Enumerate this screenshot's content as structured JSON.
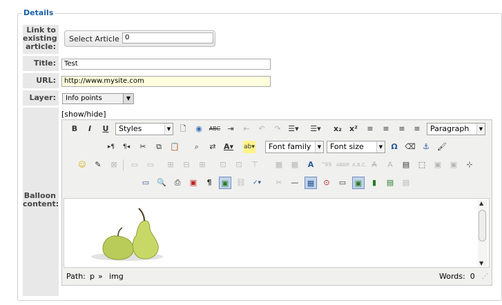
{
  "legend": "Details",
  "labels": {
    "link": "Link to existing article:",
    "title": "Title:",
    "url": "URL:",
    "layer": "Layer:",
    "balloon": "Balloon content:"
  },
  "select_article": {
    "button": "Select Article",
    "value": "0"
  },
  "title_value": "Test",
  "url_value": "http://www.mysite.com",
  "layer_value": "Info points",
  "show_hide": "[show/hide]",
  "toolbar": {
    "styles": "Styles",
    "paragraph": "Paragraph",
    "font_family": "Font family",
    "font_size": "Font size"
  },
  "status": {
    "path_label": "Path:",
    "path_p": "p",
    "path_sep": "»",
    "path_img": "img",
    "words": "Words:  0"
  },
  "colors": {
    "legend": "#1a5fa8",
    "url_bg": "#ffffdd",
    "accent": "#c2d4ea"
  },
  "icons": [
    "bold-icon",
    "italic-icon",
    "underline-icon",
    "new-document-icon",
    "help-icon",
    "strikethrough-icon",
    "indent-icon",
    "outdent-icon",
    "undo-icon",
    "redo-icon",
    "numbered-list-icon",
    "bullet-list-icon",
    "subscript-icon",
    "superscript-icon",
    "align-left-icon",
    "align-center-icon",
    "align-right-icon",
    "justify-icon",
    "ltr-icon",
    "rtl-icon",
    "cut-icon",
    "copy-icon",
    "paste-icon",
    "find-icon",
    "replace-icon",
    "text-color-icon",
    "highlight-icon",
    "special-char-icon",
    "erase-icon",
    "anchor-icon",
    "cleanup-icon",
    "emoticon-icon",
    "edit-icon",
    "table-icon",
    "image-icon",
    "horizontal-rule-icon",
    "preview-icon",
    "print-icon",
    "media-icon",
    "page-break-icon"
  ]
}
